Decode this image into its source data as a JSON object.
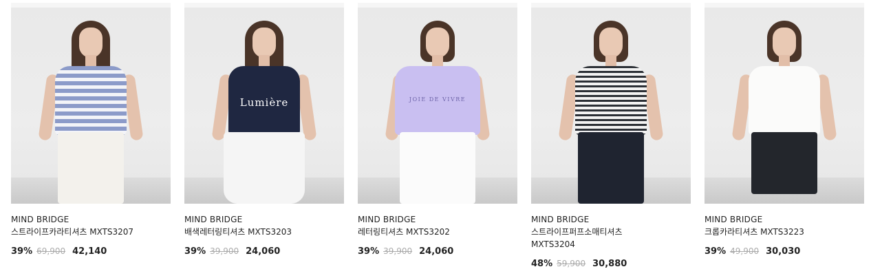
{
  "products": [
    {
      "brand": "MIND BRIDGE",
      "name": "스트라이프카라티셔츠 MXTS3207",
      "discount": "39%",
      "original_price": "69,900",
      "sale_price": "42,140",
      "image_print": ""
    },
    {
      "brand": "MIND BRIDGE",
      "name": "배색레터링티셔츠 MXTS3203",
      "discount": "39%",
      "original_price": "39,900",
      "sale_price": "24,060",
      "image_print": "Lumière"
    },
    {
      "brand": "MIND BRIDGE",
      "name": "레터링티셔츠 MXTS3202",
      "discount": "39%",
      "original_price": "39,900",
      "sale_price": "24,060",
      "image_print": "JOIE DE VIVRE"
    },
    {
      "brand": "MIND BRIDGE",
      "name": "스트라이프퍼프소매티셔츠 MXTS3204",
      "discount": "48%",
      "original_price": "59,900",
      "sale_price": "30,880",
      "image_print": ""
    },
    {
      "brand": "MIND BRIDGE",
      "name": "크롭카라티셔츠 MXTS3223",
      "discount": "39%",
      "original_price": "49,900",
      "sale_price": "30,030",
      "image_print": ""
    }
  ]
}
